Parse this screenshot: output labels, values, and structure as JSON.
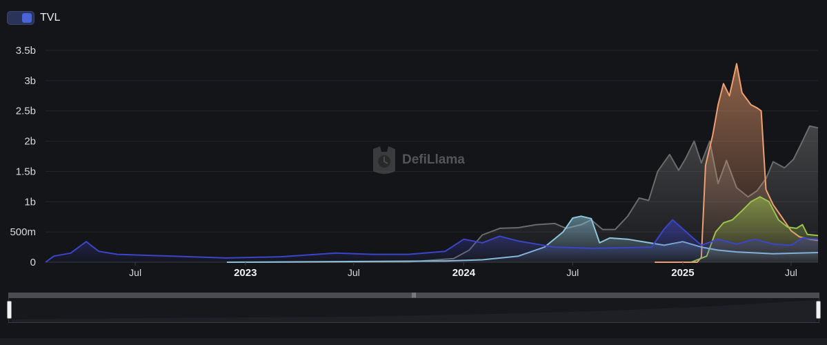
{
  "legend": {
    "label": "TVL",
    "toggle_color": "#4a63d6"
  },
  "watermark": {
    "text": "DefiLlama"
  },
  "chart_data": {
    "type": "area",
    "title": "",
    "xlabel": "",
    "ylabel": "",
    "ylim": [
      0,
      3500000000
    ],
    "xlim": [
      "2022-02-01",
      "2025-08-15"
    ],
    "grid": true,
    "legend_position": "top-left",
    "y_ticks": [
      {
        "value": 0,
        "label": "0"
      },
      {
        "value": 500000000,
        "label": "500m"
      },
      {
        "value": 1000000000,
        "label": "1b"
      },
      {
        "value": 1500000000,
        "label": "1.5b"
      },
      {
        "value": 2000000000,
        "label": "2b"
      },
      {
        "value": 2500000000,
        "label": "2.5b"
      },
      {
        "value": 3000000000,
        "label": "3b"
      },
      {
        "value": 3500000000,
        "label": "3.5b"
      }
    ],
    "x_ticks": [
      {
        "date": "2022-07-01",
        "label": "Jul",
        "bold": false
      },
      {
        "date": "2023-01-01",
        "label": "2023",
        "bold": true
      },
      {
        "date": "2023-07-01",
        "label": "Jul",
        "bold": false
      },
      {
        "date": "2024-01-01",
        "label": "2024",
        "bold": true
      },
      {
        "date": "2024-07-01",
        "label": "Jul",
        "bold": false
      },
      {
        "date": "2025-01-01",
        "label": "2025",
        "bold": true
      },
      {
        "date": "2025-07-01",
        "label": "Jul",
        "bold": false
      }
    ],
    "series": [
      {
        "color": "#6b6b6b",
        "points": [
          [
            "2023-01-01",
            0
          ],
          [
            "2023-10-01",
            5000000
          ],
          [
            "2023-12-15",
            60000000
          ],
          [
            "2024-01-10",
            200000000
          ],
          [
            "2024-02-01",
            450000000
          ],
          [
            "2024-03-01",
            560000000
          ],
          [
            "2024-04-01",
            570000000
          ],
          [
            "2024-05-01",
            620000000
          ],
          [
            "2024-06-01",
            640000000
          ],
          [
            "2024-06-20",
            560000000
          ],
          [
            "2024-07-15",
            620000000
          ],
          [
            "2024-08-01",
            700000000
          ],
          [
            "2024-08-20",
            540000000
          ],
          [
            "2024-09-10",
            540000000
          ],
          [
            "2024-10-01",
            760000000
          ],
          [
            "2024-10-20",
            1060000000
          ],
          [
            "2024-11-05",
            1020000000
          ],
          [
            "2024-11-20",
            1500000000
          ],
          [
            "2024-12-10",
            1780000000
          ],
          [
            "2024-12-25",
            1520000000
          ],
          [
            "2025-01-05",
            1700000000
          ],
          [
            "2025-01-20",
            2000000000
          ],
          [
            "2025-02-01",
            1640000000
          ],
          [
            "2025-02-15",
            2000000000
          ],
          [
            "2025-03-01",
            1300000000
          ],
          [
            "2025-03-15",
            1680000000
          ],
          [
            "2025-04-01",
            1230000000
          ],
          [
            "2025-04-20",
            1080000000
          ],
          [
            "2025-05-05",
            1180000000
          ],
          [
            "2025-05-20",
            1380000000
          ],
          [
            "2025-06-01",
            1660000000
          ],
          [
            "2025-06-20",
            1560000000
          ],
          [
            "2025-07-05",
            1700000000
          ],
          [
            "2025-07-20",
            2000000000
          ],
          [
            "2025-08-01",
            2250000000
          ],
          [
            "2025-08-15",
            2220000000
          ]
        ]
      },
      {
        "color": "#f0a070",
        "points": [
          [
            "2024-11-15",
            0
          ],
          [
            "2025-01-25",
            0
          ],
          [
            "2025-02-01",
            80000000
          ],
          [
            "2025-02-08",
            1600000000
          ],
          [
            "2025-02-20",
            2100000000
          ],
          [
            "2025-03-01",
            2600000000
          ],
          [
            "2025-03-10",
            2950000000
          ],
          [
            "2025-03-20",
            2750000000
          ],
          [
            "2025-04-01",
            3280000000
          ],
          [
            "2025-04-10",
            2800000000
          ],
          [
            "2025-04-25",
            2600000000
          ],
          [
            "2025-05-05",
            2550000000
          ],
          [
            "2025-05-12",
            2500000000
          ],
          [
            "2025-05-20",
            1200000000
          ],
          [
            "2025-06-01",
            950000000
          ],
          [
            "2025-06-15",
            750000000
          ],
          [
            "2025-07-01",
            520000000
          ],
          [
            "2025-07-15",
            420000000
          ],
          [
            "2025-08-01",
            380000000
          ],
          [
            "2025-08-15",
            360000000
          ]
        ]
      },
      {
        "color": "#9bc34a",
        "points": [
          [
            "2025-01-15",
            0
          ],
          [
            "2025-02-10",
            100000000
          ],
          [
            "2025-02-25",
            500000000
          ],
          [
            "2025-03-10",
            650000000
          ],
          [
            "2025-03-25",
            700000000
          ],
          [
            "2025-04-10",
            850000000
          ],
          [
            "2025-04-25",
            1000000000
          ],
          [
            "2025-05-10",
            1080000000
          ],
          [
            "2025-05-25",
            1000000000
          ],
          [
            "2025-06-10",
            700000000
          ],
          [
            "2025-06-25",
            580000000
          ],
          [
            "2025-07-10",
            560000000
          ],
          [
            "2025-07-20",
            620000000
          ],
          [
            "2025-07-28",
            460000000
          ],
          [
            "2025-08-15",
            440000000
          ]
        ]
      },
      {
        "color": "#8ec5dc",
        "points": [
          [
            "2022-12-01",
            0
          ],
          [
            "2023-06-01",
            10000000
          ],
          [
            "2023-12-01",
            20000000
          ],
          [
            "2024-02-01",
            40000000
          ],
          [
            "2024-04-01",
            100000000
          ],
          [
            "2024-05-15",
            250000000
          ],
          [
            "2024-06-15",
            500000000
          ],
          [
            "2024-07-01",
            730000000
          ],
          [
            "2024-07-15",
            760000000
          ],
          [
            "2024-08-01",
            720000000
          ],
          [
            "2024-08-15",
            320000000
          ],
          [
            "2024-09-01",
            400000000
          ],
          [
            "2024-10-01",
            380000000
          ],
          [
            "2024-11-01",
            330000000
          ],
          [
            "2024-12-01",
            280000000
          ],
          [
            "2025-01-01",
            340000000
          ],
          [
            "2025-02-01",
            250000000
          ],
          [
            "2025-03-01",
            200000000
          ],
          [
            "2025-04-01",
            170000000
          ],
          [
            "2025-06-01",
            140000000
          ],
          [
            "2025-08-15",
            160000000
          ]
        ]
      },
      {
        "color": "#3c45c8",
        "points": [
          [
            "2022-02-01",
            0
          ],
          [
            "2022-02-15",
            100000000
          ],
          [
            "2022-03-15",
            150000000
          ],
          [
            "2022-04-10",
            340000000
          ],
          [
            "2022-05-01",
            180000000
          ],
          [
            "2022-06-01",
            130000000
          ],
          [
            "2022-08-01",
            110000000
          ],
          [
            "2022-10-01",
            90000000
          ],
          [
            "2022-12-01",
            70000000
          ],
          [
            "2023-03-01",
            90000000
          ],
          [
            "2023-06-01",
            150000000
          ],
          [
            "2023-08-01",
            130000000
          ],
          [
            "2023-10-01",
            130000000
          ],
          [
            "2023-12-01",
            180000000
          ],
          [
            "2024-01-01",
            380000000
          ],
          [
            "2024-02-01",
            320000000
          ],
          [
            "2024-03-01",
            430000000
          ],
          [
            "2024-04-01",
            350000000
          ],
          [
            "2024-05-01",
            300000000
          ],
          [
            "2024-06-01",
            250000000
          ],
          [
            "2024-08-01",
            230000000
          ],
          [
            "2024-10-01",
            240000000
          ],
          [
            "2024-11-10",
            250000000
          ],
          [
            "2024-12-01",
            550000000
          ],
          [
            "2024-12-15",
            700000000
          ],
          [
            "2025-01-01",
            550000000
          ],
          [
            "2025-02-01",
            280000000
          ],
          [
            "2025-03-01",
            380000000
          ],
          [
            "2025-04-01",
            300000000
          ],
          [
            "2025-05-01",
            380000000
          ],
          [
            "2025-06-01",
            300000000
          ],
          [
            "2025-07-01",
            280000000
          ],
          [
            "2025-07-20",
            400000000
          ],
          [
            "2025-08-15",
            380000000
          ]
        ]
      }
    ]
  }
}
